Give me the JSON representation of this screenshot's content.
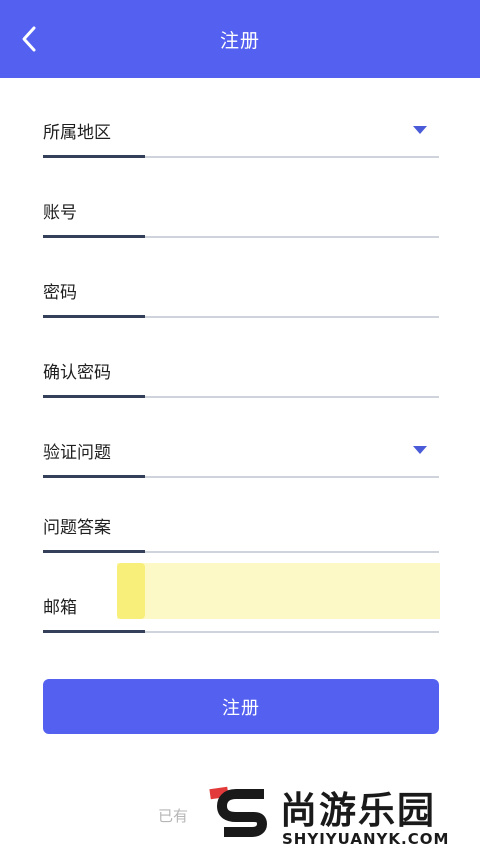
{
  "header": {
    "title": "注册",
    "back_icon": "chevron-left-icon",
    "color": "#5461f0"
  },
  "form": {
    "fields": [
      {
        "label": "所属地区",
        "type": "select"
      },
      {
        "label": "账号",
        "type": "input"
      },
      {
        "label": "密码",
        "type": "input"
      },
      {
        "label": "确认密码",
        "type": "input"
      },
      {
        "label": "验证问题",
        "type": "select"
      },
      {
        "label": "问题答案",
        "type": "input"
      },
      {
        "label": "邮箱",
        "type": "input"
      }
    ],
    "submit_label": "注册"
  },
  "footer": {
    "hint_text": "已有"
  },
  "watermark": {
    "cn_text": "尚游乐园",
    "en_text": "SHYIYUANYK.COM",
    "logo_icon": "s-logo-icon"
  }
}
